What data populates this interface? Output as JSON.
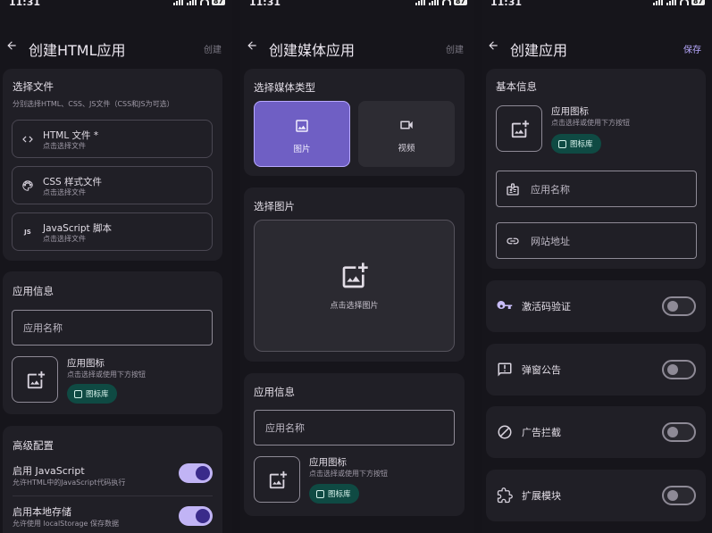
{
  "status": {
    "time": "11:31",
    "battery": "87"
  },
  "html_screen": {
    "title": "创建HTML应用",
    "action": "创建",
    "files": {
      "title": "选择文件",
      "subtitle": "分别选择HTML、CSS、JS文件（CSS和JS为可选）",
      "items": [
        {
          "name": "HTML 文件 *",
          "hint": "点击选择文件",
          "icon": "code-icon"
        },
        {
          "name": "CSS 样式文件",
          "hint": "点击选择文件",
          "icon": "palette-icon"
        },
        {
          "name": "JavaScript 脚本",
          "hint": "点击选择文件",
          "icon": "js-icon",
          "icon_text": "JS"
        }
      ]
    },
    "app_info": {
      "title": "应用信息",
      "name_placeholder": "应用名称",
      "icon_label": "应用图标",
      "icon_hint": "点击选择或使用下方按钮",
      "library_label": "图标库"
    },
    "advanced": {
      "title": "高级配置",
      "items": [
        {
          "name": "启用 JavaScript",
          "hint": "允许HTML中的JavaScript代码执行",
          "enabled": true
        },
        {
          "name": "启用本地存储",
          "hint": "允许使用 localStorage 保存数据",
          "enabled": true
        }
      ]
    }
  },
  "media_screen": {
    "title": "创建媒体应用",
    "action": "创建",
    "media_type": {
      "title": "选择媒体类型",
      "options": [
        {
          "label": "图片",
          "icon": "image-icon",
          "selected": true
        },
        {
          "label": "视频",
          "icon": "video-icon",
          "selected": false
        }
      ]
    },
    "picker": {
      "title": "选择图片",
      "hint": "点击选择图片"
    },
    "app_info": {
      "title": "应用信息",
      "name_placeholder": "应用名称",
      "icon_label": "应用图标",
      "icon_hint": "点击选择或使用下方按钮",
      "library_label": "图标库"
    }
  },
  "app_screen": {
    "title": "创建应用",
    "action": "保存",
    "basic": {
      "title": "基本信息",
      "icon_label": "应用图标",
      "icon_hint": "点击选择或使用下方按钮",
      "library_label": "图标库",
      "name_placeholder": "应用名称",
      "url_placeholder": "网站地址"
    },
    "features": [
      {
        "name": "激活码验证",
        "icon": "key-icon",
        "enabled": false
      },
      {
        "name": "弹窗公告",
        "icon": "announcement-icon",
        "enabled": false
      },
      {
        "name": "广告拦截",
        "icon": "block-icon",
        "enabled": false
      },
      {
        "name": "扩展模块",
        "icon": "extension-icon",
        "enabled": false
      }
    ]
  },
  "colors": {
    "background": "#16151b",
    "card": "#201f26",
    "accent": "#c1b4f5",
    "selected_tile": "#6f5fc4",
    "library_button": "#0f4a43",
    "save_text": "#b8a9ff"
  }
}
